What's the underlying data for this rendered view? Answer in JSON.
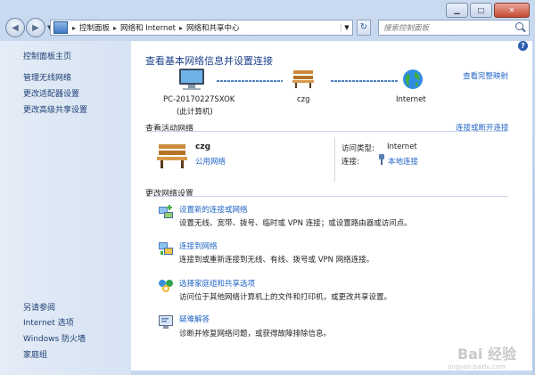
{
  "address": {
    "crumbs": [
      "控制面板",
      "网络和 Internet",
      "网络和共享中心"
    ],
    "search_placeholder": "搜索控制面板"
  },
  "window_buttons": {
    "minimize": "▁",
    "maximize": "□",
    "close": "✕"
  },
  "left_pane": {
    "home": "控制面板主页",
    "tasks": [
      "管理无线网络",
      "更改适配器设置",
      "更改高级共享设置"
    ],
    "see_also_title": "另请参阅",
    "see_also": [
      "Internet 选项",
      "Windows 防火墙",
      "家庭组"
    ]
  },
  "main": {
    "title": "查看基本网络信息并设置连接",
    "view_full_map": "查看完整映射",
    "map": {
      "computer_name": "PC-20170227SXOK",
      "computer_sub": "(此计算机)",
      "network_name": "czg",
      "internet_label": "Internet"
    },
    "active_title": "查看活动网络",
    "connect_disconnect": "连接或断开连接",
    "active_network": {
      "name": "czg",
      "type_link": "公用网络",
      "access_type_label": "访问类型:",
      "access_type_value": "Internet",
      "connections_label": "连接:",
      "connections_value": "本地连接"
    },
    "change_title": "更改网络设置",
    "tasks": [
      {
        "title": "设置新的连接或网络",
        "desc": "设置无线、宽带、拨号、临时或 VPN 连接；或设置路由器或访问点。"
      },
      {
        "title": "连接到网络",
        "desc": "连接到或重新连接到无线、有线、拨号或 VPN 网络连接。"
      },
      {
        "title": "选择家庭组和共享选项",
        "desc": "访问位于其他网络计算机上的文件和打印机，或更改共享设置。"
      },
      {
        "title": "疑难解答",
        "desc": "诊断并修复网络问题，或获得故障排除信息。"
      }
    ]
  },
  "watermark": {
    "text": "Bai 经验",
    "url": "jingyan.baidu.com"
  }
}
